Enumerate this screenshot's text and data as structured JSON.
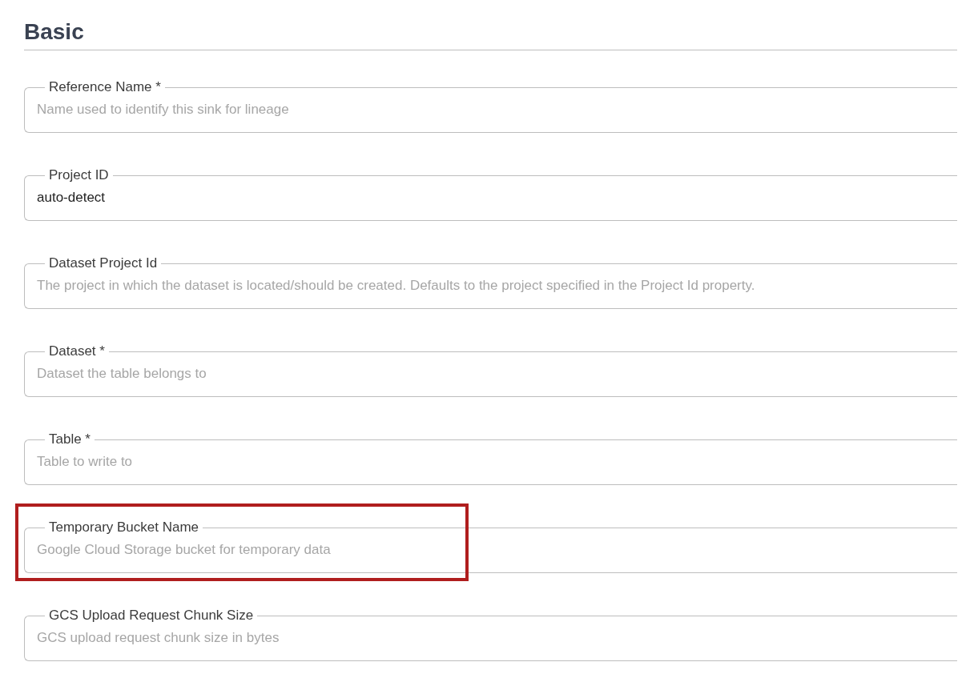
{
  "section": {
    "title": "Basic"
  },
  "fields": [
    {
      "label": "Reference Name *",
      "placeholder": "Name used to identify this sink for lineage",
      "highlighted": false
    },
    {
      "label": "Project ID",
      "value": "auto-detect",
      "highlighted": false
    },
    {
      "label": "Dataset Project Id",
      "placeholder": "The project in which the dataset is located/should be created. Defaults to the project specified in the Project Id property.",
      "highlighted": false
    },
    {
      "label": "Dataset *",
      "placeholder": "Dataset the table belongs to",
      "highlighted": false
    },
    {
      "label": "Table *",
      "placeholder": "Table to write to",
      "highlighted": false
    },
    {
      "label": "Temporary Bucket Name",
      "placeholder": "Google Cloud Storage bucket for temporary data",
      "highlighted": true
    },
    {
      "label": "GCS Upload Request Chunk Size",
      "placeholder": "GCS upload request chunk size in bytes",
      "highlighted": false
    }
  ]
}
